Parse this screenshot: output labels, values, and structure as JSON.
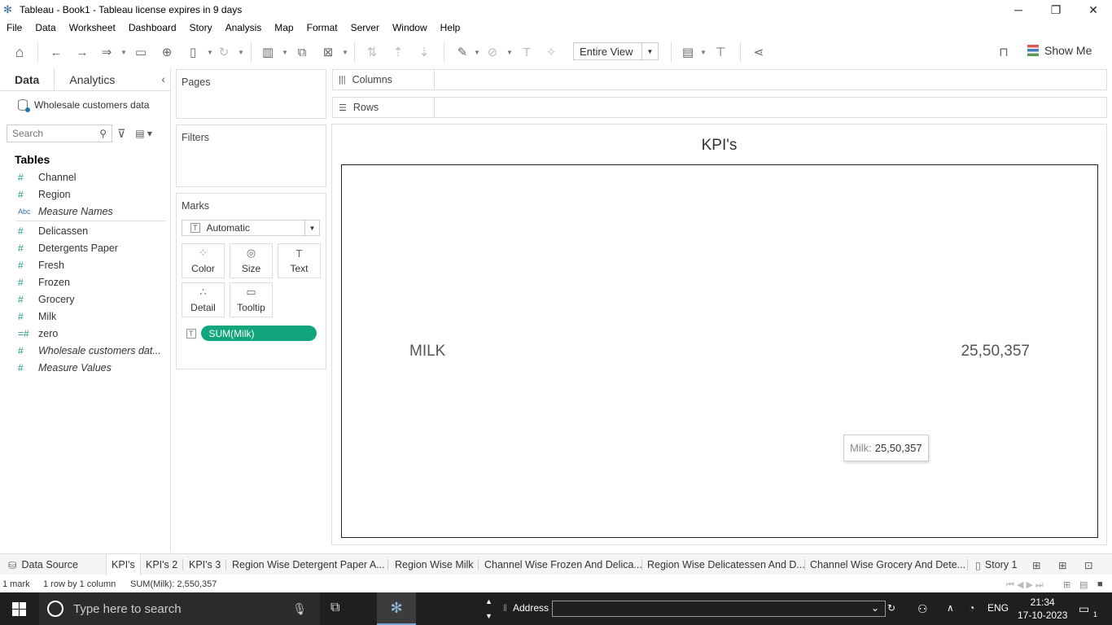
{
  "window": {
    "title": "Tableau - Book1 - Tableau license expires in 9 days"
  },
  "menu": [
    "File",
    "Data",
    "Worksheet",
    "Dashboard",
    "Story",
    "Analysis",
    "Map",
    "Format",
    "Server",
    "Window",
    "Help"
  ],
  "toolbar": {
    "view_mode": "Entire View",
    "show_me": "Show Me"
  },
  "left_pane": {
    "tabs": {
      "data": "Data",
      "analytics": "Analytics"
    },
    "datasource": "Wholesale customers data",
    "search_placeholder": "Search",
    "tables_title": "Tables",
    "fields": [
      {
        "type": "#",
        "name": "Channel",
        "italic": false
      },
      {
        "type": "#",
        "name": "Region",
        "italic": false
      },
      {
        "type": "Abc",
        "name": "Measure Names",
        "italic": true
      },
      {
        "type": "#",
        "name": "Delicassen",
        "italic": false
      },
      {
        "type": "#",
        "name": "Detergents Paper",
        "italic": false
      },
      {
        "type": "#",
        "name": "Fresh",
        "italic": false
      },
      {
        "type": "#",
        "name": "Frozen",
        "italic": false
      },
      {
        "type": "#",
        "name": "Grocery",
        "italic": false
      },
      {
        "type": "#",
        "name": "Milk",
        "italic": false
      },
      {
        "type": "=#",
        "name": "zero",
        "italic": false
      },
      {
        "type": "#",
        "name": "Wholesale customers dat...",
        "italic": true
      },
      {
        "type": "#",
        "name": "Measure Values",
        "italic": true
      }
    ]
  },
  "cards": {
    "pages": "Pages",
    "filters": "Filters",
    "marks": "Marks",
    "mark_type": "Automatic",
    "mark_buttons": {
      "color": "Color",
      "size": "Size",
      "text": "Text",
      "detail": "Detail",
      "tooltip": "Tooltip"
    },
    "text_pill": "SUM(Milk)"
  },
  "shelves": {
    "columns": "Columns",
    "rows": "Rows"
  },
  "view": {
    "title": "KPI's",
    "kpi_label": "MILK",
    "kpi_value": "25,50,357",
    "tooltip_key": "Milk:",
    "tooltip_value": "25,50,357"
  },
  "sheet_tabs": {
    "data_source": "Data Source",
    "sheets": [
      "KPI's",
      "KPI's 2",
      "KPI's 3",
      "Region Wise Detergent Paper A...",
      "Region Wise Milk",
      "Channel Wise Frozen And Delica...",
      "Region Wise Delicatessen And D...",
      "Channel Wise Grocery And Dete...",
      "Story 1"
    ]
  },
  "status": {
    "marks": "1 mark",
    "rows_cols": "1 row by 1 column",
    "sum": "SUM(Milk): 2,550,357"
  },
  "taskbar": {
    "search_placeholder": "Type here to search",
    "address_label": "Address",
    "language": "ENG",
    "time": "21:34",
    "date": "17-10-2023",
    "notifications": "1"
  }
}
